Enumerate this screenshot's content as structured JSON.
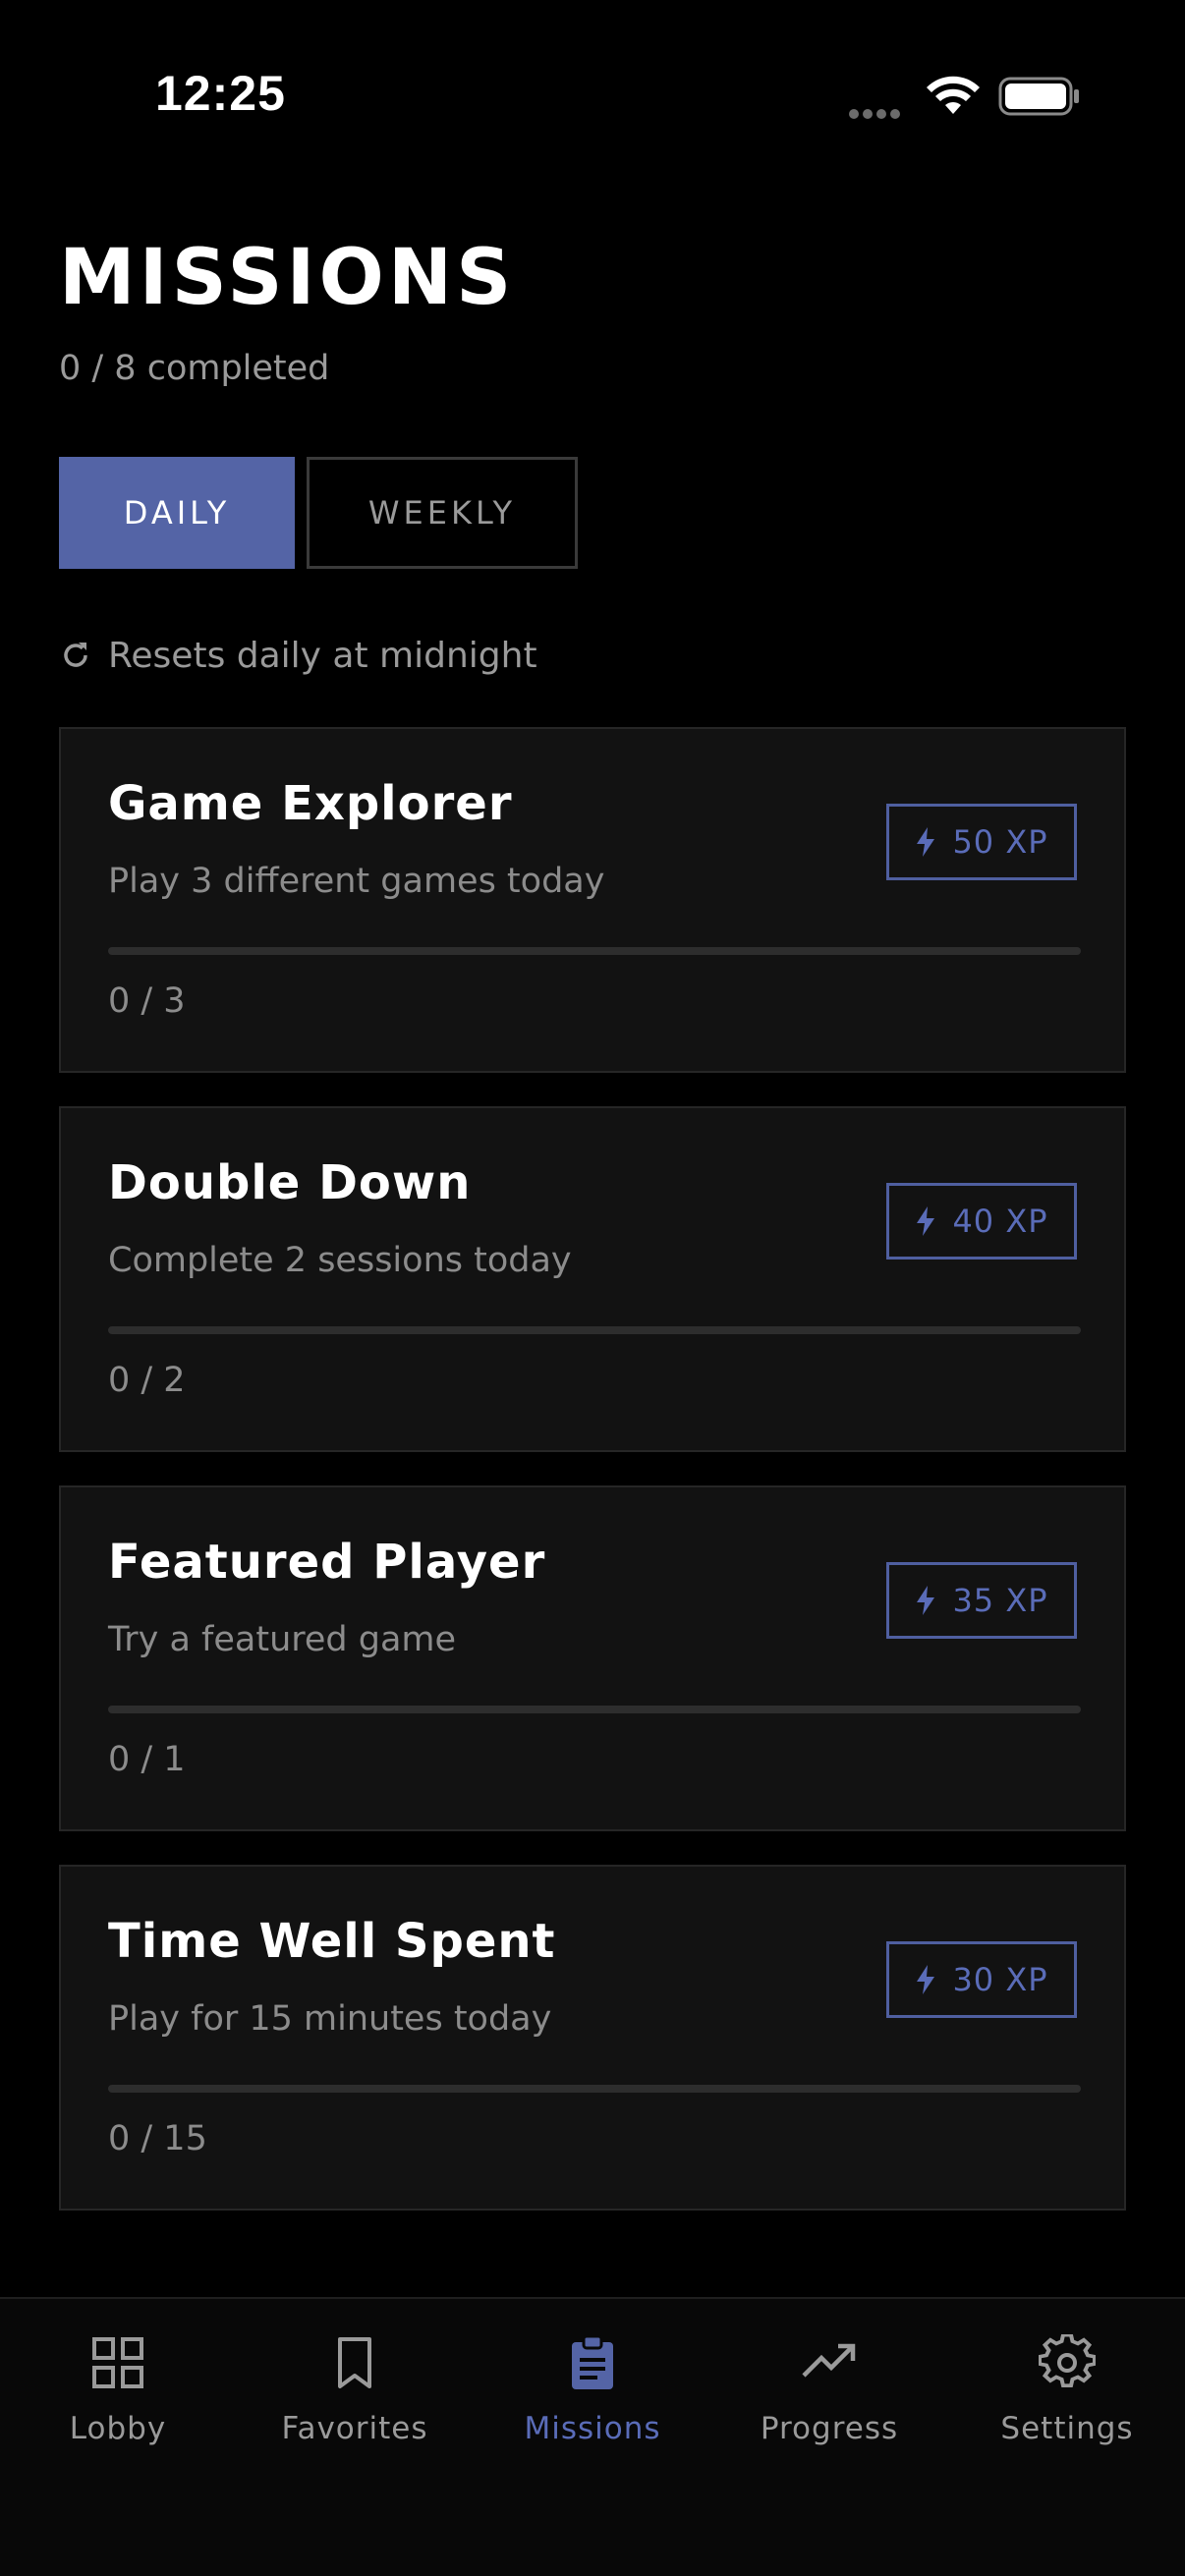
{
  "status_bar": {
    "time": "12:25"
  },
  "header": {
    "title": "MISSIONS",
    "subtitle": "0 / 8 completed"
  },
  "tabs": [
    {
      "label": "DAILY",
      "selected": true
    },
    {
      "label": "WEEKLY",
      "selected": false
    }
  ],
  "reset_note": {
    "text": "Resets daily at midnight",
    "icon": "refresh-icon"
  },
  "missions": [
    {
      "title": "Game Explorer",
      "description": "Play 3 different games today",
      "xp": "50 XP",
      "progress_text": "0 / 3",
      "progress": 0
    },
    {
      "title": "Double Down",
      "description": "Complete 2 sessions today",
      "xp": "40 XP",
      "progress_text": "0 / 2",
      "progress": 0
    },
    {
      "title": "Featured Player",
      "description": "Try a featured game",
      "xp": "35 XP",
      "progress_text": "0 / 1",
      "progress": 0
    },
    {
      "title": "Time Well Spent",
      "description": "Play for 15 minutes today",
      "xp": "30 XP",
      "progress_text": "0 / 15",
      "progress": 0
    }
  ],
  "nav": {
    "items": [
      {
        "label": "Lobby",
        "icon": "grid-icon"
      },
      {
        "label": "Favorites",
        "icon": "bookmark-icon"
      },
      {
        "label": "Missions",
        "icon": "clipboard-icon",
        "active": true
      },
      {
        "label": "Progress",
        "icon": "trending-up-icon"
      },
      {
        "label": "Settings",
        "icon": "gear-icon"
      }
    ]
  },
  "colors": {
    "background": "#000000",
    "accent": "#5464a6",
    "card": "#121212",
    "muted_text": "#9a9a9a"
  }
}
